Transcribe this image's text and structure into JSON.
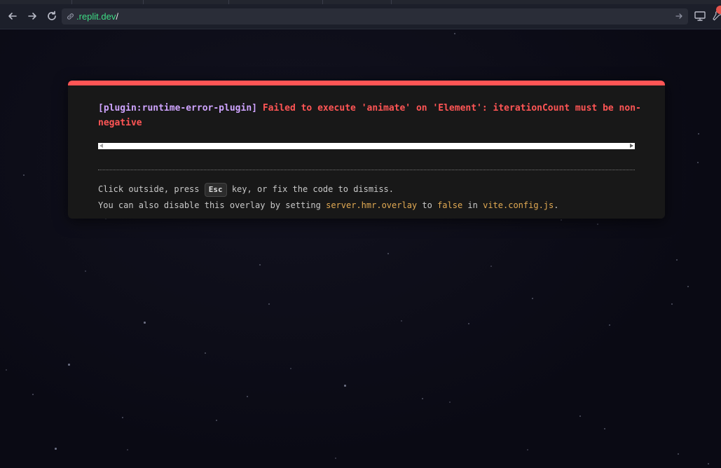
{
  "browser": {
    "url_host": ".replit.dev",
    "url_path": "/",
    "icons": [
      "back-icon",
      "forward-icon",
      "reload-icon",
      "link-icon",
      "go-icon",
      "device-icon",
      "extensions-icon"
    ]
  },
  "overlay": {
    "plugin": "[plugin:runtime-error-plugin]",
    "message": "Failed to execute 'animate' on 'Element': iterationCount must be non-negative",
    "tip_line1_a": "Click outside, press ",
    "tip_key": "Esc",
    "tip_line1_b": " key, or fix the code to dismiss.",
    "tip_line2_a": "You can also disable this overlay by setting ",
    "tip_code1": "server.hmr.overlay",
    "tip_line2_b": " to ",
    "tip_code2": "false",
    "tip_line2_c": " in ",
    "tip_code3": "vite.config.js",
    "tip_line2_d": "."
  },
  "colors": {
    "error": "#ff5555",
    "plugin": "#cfa4ff",
    "code": "#e2aa53",
    "url_host": "#3ddc84"
  }
}
